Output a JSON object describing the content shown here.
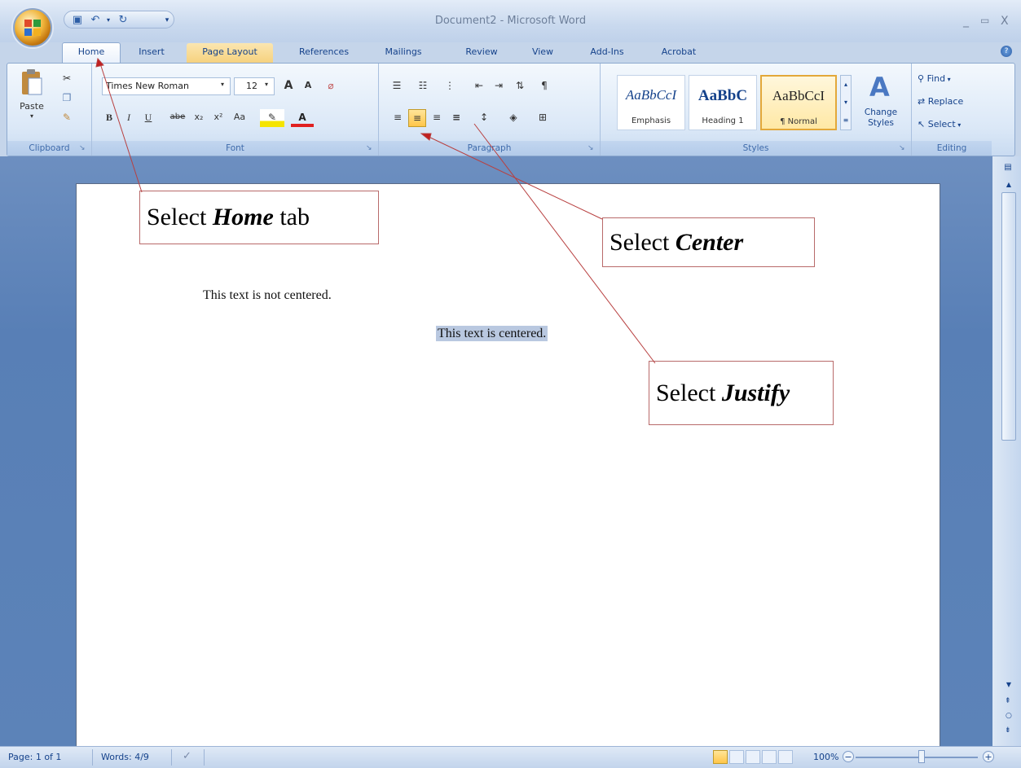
{
  "window": {
    "title": "Document2 - Microsoft Word",
    "min": "_",
    "restore": "▭",
    "close": "X"
  },
  "tabs": [
    "Home",
    "Insert",
    "Page Layout",
    "References",
    "Mailings",
    "Review",
    "View",
    "Add-Ins",
    "Acrobat"
  ],
  "clipboard": {
    "paste": "Paste",
    "label": "Clipboard"
  },
  "font": {
    "name": "Times New Roman",
    "size": "12",
    "grow": "A",
    "shrink": "A",
    "bold": "B",
    "italic": "I",
    "underline": "U",
    "strike": "abe",
    "sub": "x₂",
    "sup": "x²",
    "case": "Aa",
    "color_letter": "A",
    "label": "Font"
  },
  "paragraph": {
    "label": "Paragraph",
    "pilcrow": "¶"
  },
  "styles": {
    "label": "Styles",
    "items": [
      {
        "sample": "AaBbCcI",
        "name": "Emphasis"
      },
      {
        "sample": "AaBbC",
        "name": "Heading 1"
      },
      {
        "sample": "AaBbCcI",
        "name": "¶ Normal"
      }
    ],
    "change": "Change Styles"
  },
  "editing": {
    "label": "Editing",
    "find": "Find",
    "replace": "Replace",
    "select": "Select"
  },
  "document": {
    "line1": "This text is not centered.",
    "line2": "This text is centered."
  },
  "callouts": {
    "home": {
      "pre": "Select ",
      "em": "Home",
      "post": " tab"
    },
    "center": {
      "pre": "Select ",
      "em": "Center",
      "post": ""
    },
    "justify": {
      "pre": "Select ",
      "em": "Justify",
      "post": ""
    }
  },
  "status": {
    "page": "Page: 1 of 1",
    "words": "Words: 4/9",
    "zoom": "100%"
  }
}
